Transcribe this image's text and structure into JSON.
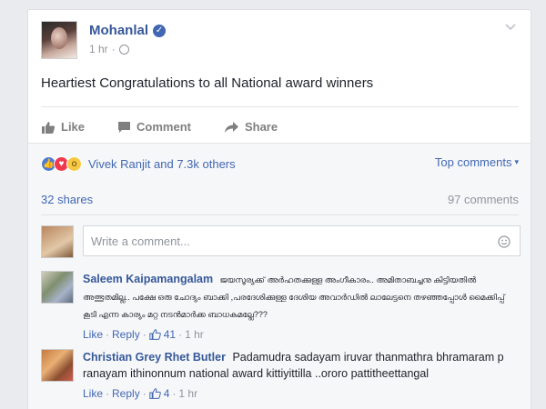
{
  "post": {
    "author": "Mohanlal",
    "verified_icon": "verified-check-icon",
    "time": "1 hr",
    "privacy_sep": "·",
    "text": "Heartiest Congratulations to all National award winners"
  },
  "actions": {
    "like": "Like",
    "comment": "Comment",
    "share": "Share"
  },
  "reactions": {
    "icons": [
      "like-reaction-icon",
      "love-reaction-icon",
      "wow-reaction-icon"
    ],
    "summary": "Vivek Ranjit and 7.3k others",
    "sort_label": "Top comments",
    "sort_caret": "▾"
  },
  "counts": {
    "shares": "32 shares",
    "comments": "97 comments"
  },
  "composer": {
    "placeholder": "Write a comment..."
  },
  "comments": [
    {
      "author": "Saleem Kaipamangalam",
      "text": "ജയസൂര്യക്ക് അർഹതക്കുള്ള അംഗീകാരം.. അമിതാബച്ചനു കിട്ടിയതിൽ അത്ഭുതമില്ല.. പക്ഷേ ഒരു ചോദ്യം ബാക്കി ,പരദേശിക്കുള്ള ദേശിയ അവാർഡിൽ ലാലേട്ടനെ തഴഞ്ഞപ്പോൾ മൈക്കിപ്പ് കൂടി എന്ന കാര്യം മറ്റ നടൻമാർക്ക ബാധകമല്ലേ???",
      "like": "Like",
      "reply": "Reply",
      "sep": "·",
      "likes": "41",
      "time": "1 hr"
    },
    {
      "author": "Christian Grey Rhet Butler",
      "text": "Padamudra sadayam iruvar thanmathra bhramaram p ranayam ithinonnum national award kittiyittilla ..ororo pattitheettangal",
      "like": "Like",
      "reply": "Reply",
      "sep": "·",
      "likes": "4",
      "time": "1 hr"
    }
  ],
  "colors": {
    "link": "#4267b2",
    "name": "#365899",
    "muted": "#90949c",
    "background": "#e9ebee"
  }
}
